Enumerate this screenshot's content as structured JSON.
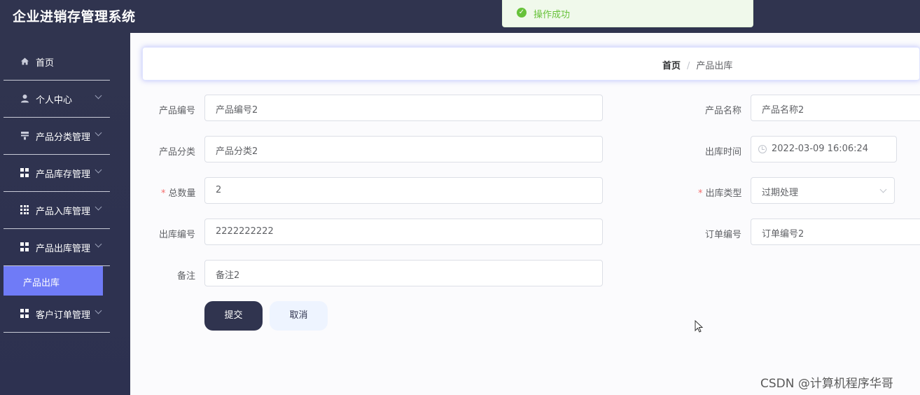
{
  "app": {
    "title": "企业进销存管理系统"
  },
  "toast": {
    "text": "操作成功",
    "icon": "check-circle-icon",
    "color": "#67c23a"
  },
  "sidebar": {
    "items": [
      {
        "label": "首页",
        "icon": "home-icon"
      },
      {
        "label": "个人中心",
        "icon": "user-icon"
      },
      {
        "label": "产品分类管理",
        "icon": "category-icon"
      },
      {
        "label": "产品库存管理",
        "icon": "grid-icon"
      },
      {
        "label": "产品入库管理",
        "icon": "grid-icon"
      },
      {
        "label": "产品出库管理",
        "icon": "grid-icon"
      },
      {
        "label": "客户订单管理",
        "icon": "grid-icon"
      }
    ],
    "active_sub": {
      "label": "产品出库"
    }
  },
  "breadcrumb": {
    "home": "首页",
    "separator": "/",
    "current": "产品出库"
  },
  "form": {
    "product_code": {
      "label": "产品编号",
      "value": "产品编号2"
    },
    "product_name": {
      "label": "产品名称",
      "value": "产品名称2"
    },
    "category": {
      "label": "产品分类",
      "value": "产品分类2"
    },
    "outbound_time": {
      "label": "出库时间",
      "value": "2022-03-09 16:06:24"
    },
    "total_qty": {
      "label": "总数量",
      "required": "*",
      "value": "2"
    },
    "outbound_type": {
      "label": "出库类型",
      "required": "*",
      "value": "过期处理"
    },
    "outbound_code": {
      "label": "出库编号",
      "value": "2222222222"
    },
    "order_code": {
      "label": "订单编号",
      "value": "订单编号2"
    },
    "remark": {
      "label": "备注",
      "value": "备注2"
    }
  },
  "buttons": {
    "submit": "提交",
    "cancel": "取消"
  },
  "watermark": "CSDN @计算机程序华哥",
  "colors": {
    "sidebar": "#30344f",
    "active": "#6f7bf7",
    "required": "#f56c6c"
  }
}
